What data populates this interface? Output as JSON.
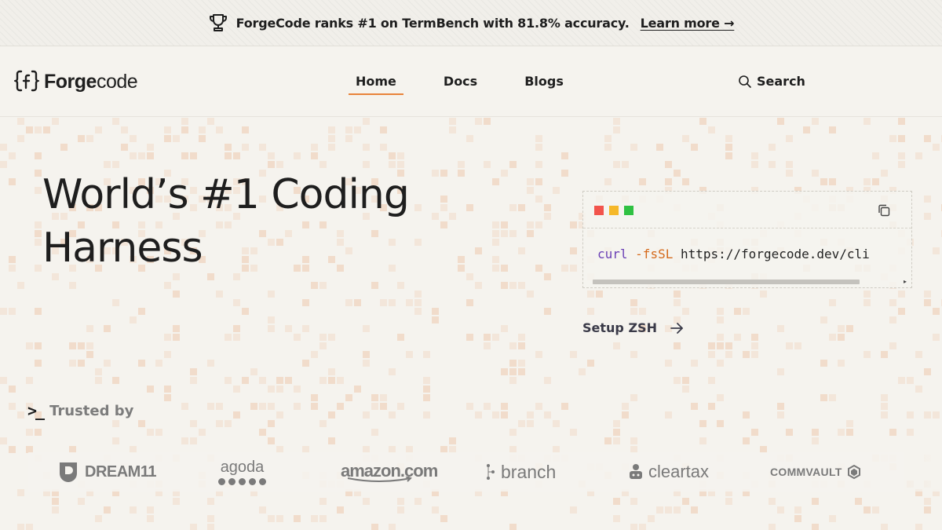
{
  "announcement": {
    "text": "ForgeCode ranks #1 on TermBench with 81.8% accuracy.",
    "link_label": "Learn more →",
    "icon": "trophy-icon"
  },
  "nav": {
    "brand_bold": "Forge",
    "brand_light": "code",
    "links": [
      {
        "label": "Home",
        "active": true
      },
      {
        "label": "Docs",
        "active": false
      },
      {
        "label": "Blogs",
        "active": false
      }
    ],
    "search_label": "Search"
  },
  "hero": {
    "headline_line1": "World’s #1 Coding",
    "headline_line2": "Harness"
  },
  "terminal": {
    "command": "curl",
    "flag": "-fsSL",
    "url": "https://forgecode.dev/cli",
    "window_colors": [
      "#f2544c",
      "#f5b829",
      "#2fc142"
    ]
  },
  "setup_link": "Setup ZSH",
  "trusted": {
    "prompt": ">_",
    "label": "Trusted by",
    "logos": [
      "DREAM11",
      "agoda",
      "amazon.com",
      "branch",
      "cleartax",
      "COMMVAULT"
    ]
  },
  "colors": {
    "accent": "#e8833a",
    "background": "#f5f3ee"
  }
}
